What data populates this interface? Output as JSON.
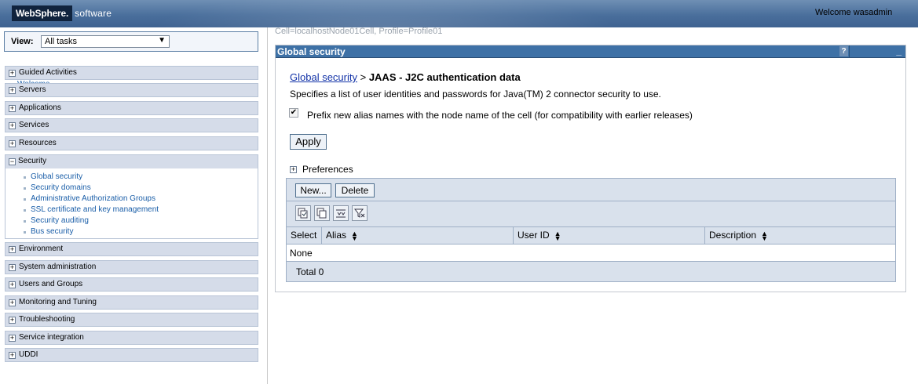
{
  "header": {
    "brand": "WebSphere.",
    "brand_suffix": "software",
    "welcome": "Welcome wasadmin",
    "accent": "#4a6f9c"
  },
  "nav": {
    "view_label": "View:",
    "view_selected": "All tasks",
    "welcome_link": "Welcome",
    "groups_top": [
      "Guided Activities",
      "Servers",
      "Applications",
      "Services",
      "Resources"
    ],
    "security": {
      "label": "Security",
      "items": [
        "Global security",
        "Security domains",
        "Administrative Authorization Groups",
        "SSL certificate and key management",
        "Security auditing",
        "Bus security"
      ]
    },
    "groups_bottom": [
      "Environment",
      "System administration",
      "Users and Groups",
      "Monitoring and Tuning",
      "Troubleshooting",
      "Service integration",
      "UDDI"
    ]
  },
  "main": {
    "scope": "Cell=localhostNode01Cell, Profile=Profile01",
    "panel_title": "Global security",
    "help": "?",
    "minimize": "_",
    "crumb_link": "Global security",
    "crumb_sep": " > ",
    "crumb_current": "JAAS - J2C authentication data",
    "description": "Specifies a list of user identities and passwords for Java(TM) 2 connector security to use.",
    "checkbox_label": "Prefix new alias names with the node name of the cell (for compatibility with earlier releases)",
    "checkbox_checked": true,
    "apply": "Apply",
    "preferences": "Preferences",
    "table": {
      "new_button": "New...",
      "delete_button": "Delete",
      "icons": [
        "select-all-icon",
        "deselect-all-icon",
        "show-filter-icon",
        "clear-filter-icon"
      ],
      "columns": [
        "Select",
        "Alias",
        "User ID",
        "Description"
      ],
      "empty_text": "None",
      "total": "Total 0"
    }
  }
}
